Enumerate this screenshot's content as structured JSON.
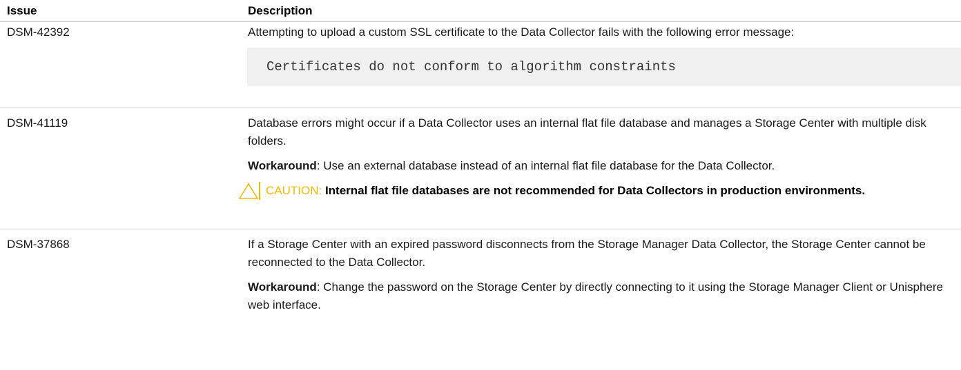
{
  "header": {
    "issue_label": "Issue",
    "description_label": "Description"
  },
  "rows": [
    {
      "id": "DSM-42392",
      "para1": "Attempting to upload a custom SSL certificate to the Data Collector fails with the following error message:",
      "code": "Certificates do not conform to algorithm constraints"
    },
    {
      "id": "DSM-41119",
      "para1": "Database errors might occur if a Data Collector uses an internal flat file database and manages a Storage Center with multiple disk folders.",
      "workaround_label": "Workaround",
      "workaround_text": ": Use an external database instead of an internal flat file database for the Data Collector.",
      "caution_label": "CAUTION: ",
      "caution_text": "Internal flat file databases are not recommended for Data Collectors in production environments."
    },
    {
      "id": "DSM-37868",
      "para1": "If a Storage Center with an expired password disconnects from the Storage Manager Data Collector, the Storage Center cannot be reconnected to the Data Collector.",
      "workaround_label": "Workaround",
      "workaround_text": ": Change the password on the Storage Center by directly connecting to it using the Storage Manager Client or Unisphere web interface."
    }
  ],
  "colors": {
    "caution": "#f5b800",
    "code_bg": "#f0f0f0",
    "row_border": "#d6d6d6"
  },
  "icons": {
    "caution": "caution-triangle-icon"
  }
}
